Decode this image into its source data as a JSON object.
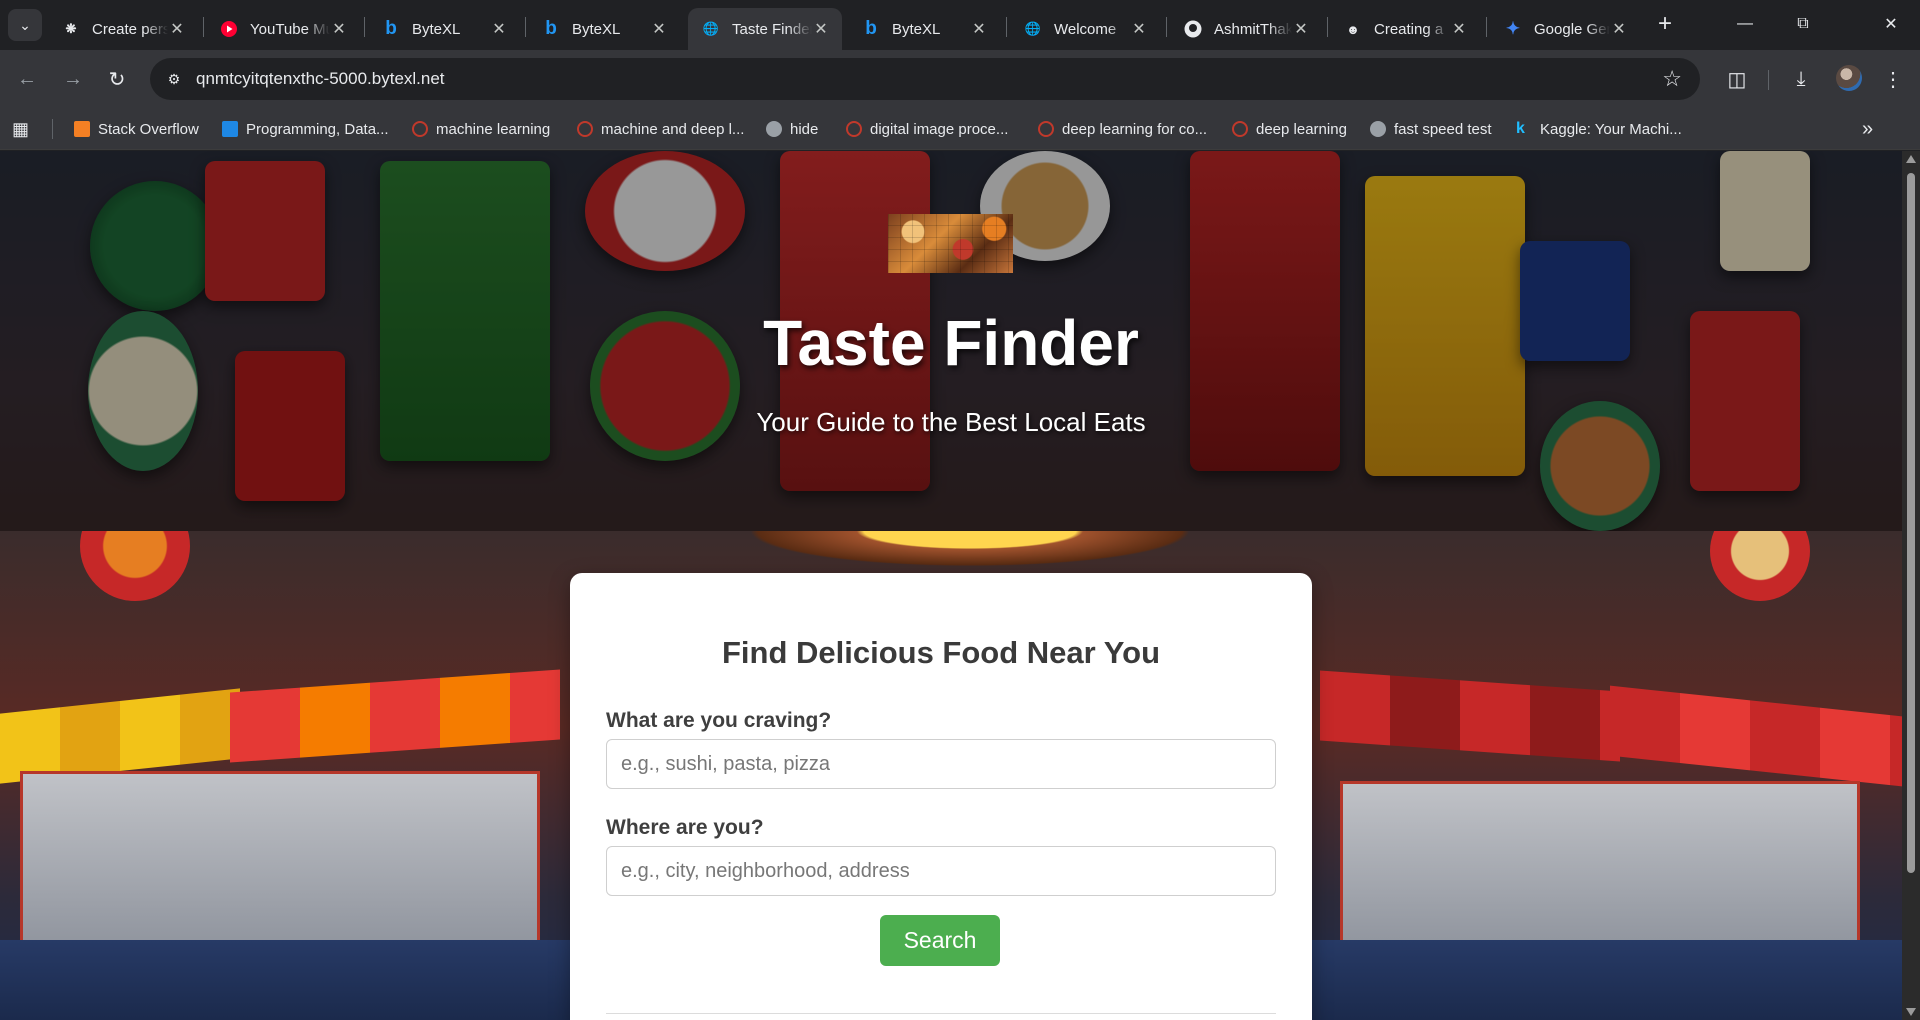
{
  "browser": {
    "tabs": [
      {
        "title": "Create personal",
        "icon": "openai-icon",
        "active": false
      },
      {
        "title": "YouTube Music",
        "icon": "youtube-icon",
        "active": false
      },
      {
        "title": "ByteXL",
        "icon": "bytexl-icon",
        "active": false
      },
      {
        "title": "ByteXL",
        "icon": "bytexl-icon",
        "active": false
      },
      {
        "title": "Taste Finder",
        "icon": "globe-icon",
        "active": true
      },
      {
        "title": "ByteXL",
        "icon": "bytexl-icon",
        "active": false
      },
      {
        "title": "Welcome",
        "icon": "globe-icon",
        "active": false
      },
      {
        "title": "AshmitThakur",
        "icon": "github-icon",
        "active": false
      },
      {
        "title": "Creating a",
        "icon": "copilot-icon",
        "active": false
      },
      {
        "title": "Google Gemini",
        "icon": "gemini-icon",
        "active": false
      }
    ],
    "address": "qnmtcyitqtenxthc-5000.bytexl.net",
    "bookmarks": [
      {
        "label": "Stack Overflow",
        "color": "#f48024"
      },
      {
        "label": "Programming, Data...",
        "color": "#1e88e5"
      },
      {
        "label": "machine learning",
        "color": "#c0392b"
      },
      {
        "label": "machine and deep l...",
        "color": "#c0392b"
      },
      {
        "label": "hide",
        "color": "#9aa0a6"
      },
      {
        "label": "digital image proce...",
        "color": "#c0392b"
      },
      {
        "label": "deep learning for co...",
        "color": "#c0392b"
      },
      {
        "label": "deep learning",
        "color": "#c0392b"
      },
      {
        "label": "fast speed test",
        "color": "#9aa0a6"
      },
      {
        "label": "Kaggle: Your Machi...",
        "color": "#20beff"
      }
    ]
  },
  "hero": {
    "title": "Taste Finder",
    "subtitle": "Your Guide to the Best Local Eats"
  },
  "search_card": {
    "heading": "Find Delicious Food Near You",
    "craving_label": "What are you craving?",
    "craving_value": "",
    "craving_placeholder": "e.g., sushi, pasta, pizza",
    "location_label": "Where are you?",
    "location_value": "",
    "location_placeholder": "e.g., city, neighborhood, address",
    "button_label": "Search",
    "button_color": "#4cae4f"
  }
}
